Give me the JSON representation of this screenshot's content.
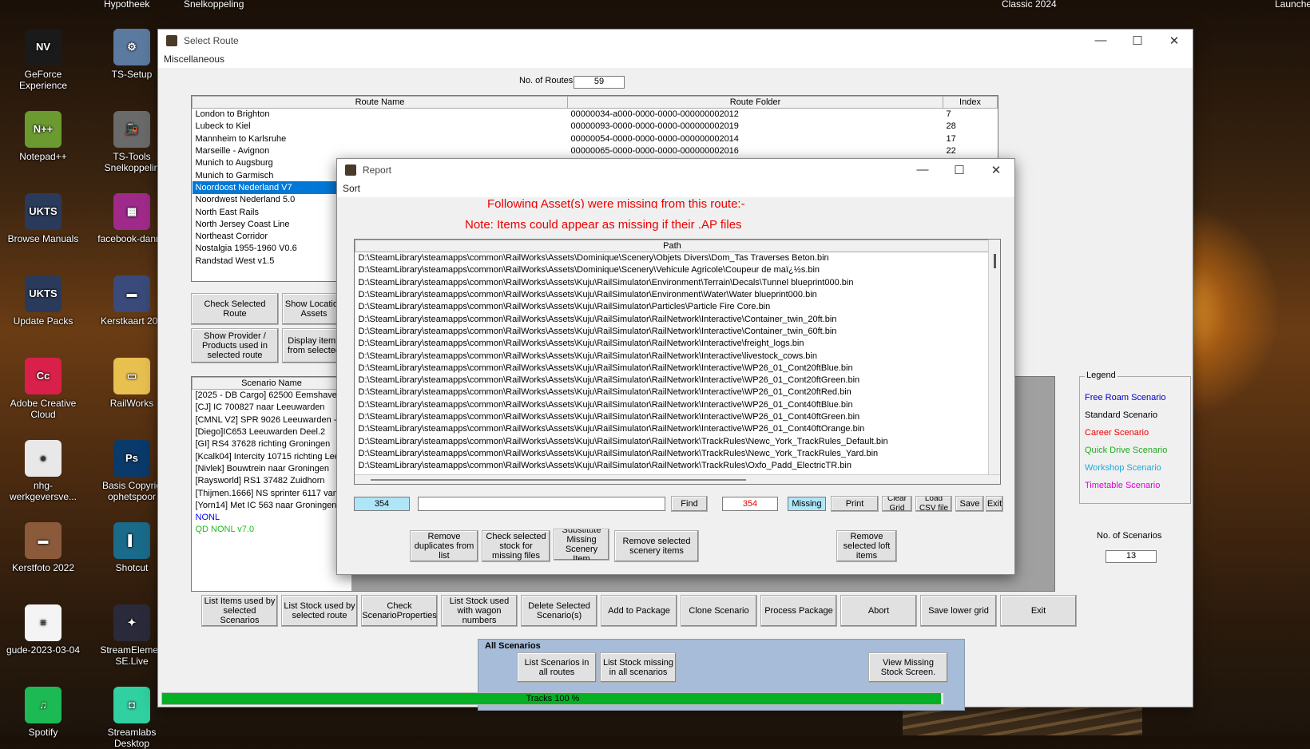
{
  "desktop": {
    "top_labels": [
      "Hypotheek",
      "Snelkoppeling",
      "Classic 2024",
      "Launche"
    ],
    "icons_col1": [
      {
        "label": "GeForce Experience",
        "pic": "NV",
        "color": "#1a1a1a"
      },
      {
        "label": "Notepad++",
        "pic": "N++",
        "color": "#6a9a30"
      },
      {
        "label": "Browse Manuals",
        "pic": "UKTS",
        "color": "#2a3a5a"
      },
      {
        "label": "Update Packs",
        "pic": "UKTS",
        "color": "#2a3a5a"
      },
      {
        "label": "Adobe Creative Cloud",
        "pic": "Cc",
        "color": "#d8204a"
      },
      {
        "label": "nhg-werkgeversve...",
        "pic": "●",
        "color": "#e8e8e8"
      },
      {
        "label": "Kerstfoto 2022",
        "pic": "▬",
        "color": "#8a5a3a"
      },
      {
        "label": "gude-2023-03-04",
        "pic": "≡",
        "color": "#f4f4f4"
      },
      {
        "label": "Spotify",
        "pic": "♫",
        "color": "#1db954"
      }
    ],
    "icons_col2": [
      {
        "label": "TS-Setup",
        "pic": "⚙",
        "color": "#5a7aa0"
      },
      {
        "label": "TS-Tools Snelkoppelin",
        "pic": "🚂",
        "color": "#6a6a6a"
      },
      {
        "label": "facebook-danny",
        "pic": "▦",
        "color": "#a02a8a"
      },
      {
        "label": "Kerstkaart 202",
        "pic": "▬",
        "color": "#3a4a7a"
      },
      {
        "label": "RailWorks",
        "pic": "▭",
        "color": "#e8c050"
      },
      {
        "label": "Basis Copyrig ophetspoor",
        "pic": "Ps",
        "color": "#0a3a6a"
      },
      {
        "label": "Shotcut",
        "pic": "▌",
        "color": "#1a6a8a"
      },
      {
        "label": "StreamElemen SE.Live",
        "pic": "✦",
        "color": "#2a2a3a"
      },
      {
        "label": "Streamlabs Desktop",
        "pic": "◘",
        "color": "#30d0a0"
      }
    ]
  },
  "select_route": {
    "title": "Select Route",
    "menu": "Miscellaneous",
    "no_routes_label": "No. of Routes",
    "no_routes_value": "59",
    "route_headers": [
      "Route Name",
      "Route Folder",
      "Index"
    ],
    "routes": [
      {
        "name": "London to Brighton",
        "folder": "00000034-a000-0000-0000-000000002012",
        "index": "7"
      },
      {
        "name": "Lubeck to Kiel",
        "folder": "00000093-0000-0000-0000-000000002019",
        "index": "28"
      },
      {
        "name": "Mannheim to Karlsruhe",
        "folder": "00000054-0000-0000-0000-000000002014",
        "index": "17"
      },
      {
        "name": "Marseille - Avignon",
        "folder": "00000065-0000-0000-0000-000000002016",
        "index": "22"
      },
      {
        "name": "Munich to Augsburg",
        "folder": "",
        "index": ""
      },
      {
        "name": "Munich to Garmisch",
        "folder": "",
        "index": ""
      },
      {
        "name": "Noordoost Nederland V7",
        "folder": "",
        "index": ""
      },
      {
        "name": "Noordwest Nederland 5.0",
        "folder": "",
        "index": ""
      },
      {
        "name": "North East Rails",
        "folder": "",
        "index": ""
      },
      {
        "name": "North Jersey Coast Line",
        "folder": "",
        "index": ""
      },
      {
        "name": "Northeast Corridor",
        "folder": "",
        "index": ""
      },
      {
        "name": "Nostalgia 1955-1960 V0.6",
        "folder": "",
        "index": ""
      },
      {
        "name": "Randstad West v1.5",
        "folder": "",
        "index": ""
      }
    ],
    "selected_route": "Noordoost Nederland V7",
    "btn_check_route": "Check Selected Route",
    "btn_show_locations": "Show Location Assets",
    "btn_show_provider": "Show Provider / Products used in selected route",
    "btn_display_items": "Display items from selected",
    "scenario_header": "Scenario Name",
    "scenarios": [
      {
        "name": "[2025 - DB Cargo] 62500 Eemshaven",
        "color": "#000"
      },
      {
        "name": "[CJ] IC 700827 naar Leeuwarden",
        "color": "#000"
      },
      {
        "name": "[CMNL V2] SPR 9026 Leeuwarden - N",
        "color": "#000"
      },
      {
        "name": "[Diego]IC653 Leeuwarden Deel.2",
        "color": "#000"
      },
      {
        "name": "[GI] RS4 37628 richting Groningen",
        "color": "#000"
      },
      {
        "name": "[Kcalk04] Intercity 10715 richting Leeu",
        "color": "#000"
      },
      {
        "name": "[Nivlek] Bouwtrein naar Groningen",
        "color": "#000"
      },
      {
        "name": "[Raysworld] RS1 37482 Zuidhorn",
        "color": "#000"
      },
      {
        "name": "[Thijmen.1666] NS sprinter 6117 van Z",
        "color": "#000"
      },
      {
        "name": "[Yorn14] Met IC 563 naar Groningen E",
        "color": "#000"
      },
      {
        "name": "NONL",
        "color": "#0000ff"
      },
      {
        "name": "QD NONL v7.0",
        "color": "#22bb22"
      }
    ],
    "legend_title": "Legend",
    "legend": [
      {
        "label": "Free Roam Scenario",
        "color": "#0000cc"
      },
      {
        "label": "Standard Scenario",
        "color": "#000000"
      },
      {
        "label": "Career Scenario",
        "color": "#ee0000"
      },
      {
        "label": "Quick Drive Scenario",
        "color": "#22aa22"
      },
      {
        "label": "Workshop Scenario",
        "color": "#1aaadd"
      },
      {
        "label": "Timetable Scenario",
        "color": "#dd00dd"
      }
    ],
    "no_scenarios_label": "No. of Scenarios",
    "no_scenarios_value": "13",
    "bottom_buttons": [
      "List Items used by selected Scenarios",
      "List Stock used by selected route",
      "Check ScenarioProperties",
      "List Stock used with wagon numbers",
      "Delete Selected Scenario(s)",
      "Add to Package",
      "Clone Scenario",
      "Process Package",
      "Abort",
      "Save lower grid",
      "Exit"
    ],
    "all_scenarios_title": "All Scenarios",
    "btn_list_scenarios_all": "List Scenarios in all routes",
    "btn_list_stock_missing": "List Stock missing in all scenarios",
    "btn_view_missing": "View Missing Stock Screen.",
    "progress_label": "Tracks 100 %",
    "progress_fraction": 0.997
  },
  "report": {
    "title": "Report",
    "menu": "Sort",
    "msg1": "Following Asset(s) were missing from this route:-",
    "msg2": "Note: Items could appear as missing if their .AP files",
    "path_header": "Path",
    "paths": [
      "D:\\SteamLibrary\\steamapps\\common\\RailWorks\\Assets\\Dominique\\Scenery\\Objets Divers\\Dom_Tas Traverses Beton.bin",
      "D:\\SteamLibrary\\steamapps\\common\\RailWorks\\Assets\\Dominique\\Scenery\\Vehicule Agricole\\Coupeur de maï¿½s.bin",
      "D:\\SteamLibrary\\steamapps\\common\\RailWorks\\Assets\\Kuju\\RailSimulator\\Environment\\Terrain\\Decals\\Tunnel blueprint000.bin",
      "D:\\SteamLibrary\\steamapps\\common\\RailWorks\\Assets\\Kuju\\RailSimulator\\Environment\\Water\\Water blueprint000.bin",
      "D:\\SteamLibrary\\steamapps\\common\\RailWorks\\Assets\\Kuju\\RailSimulator\\Particles\\Particle Fire Core.bin",
      "D:\\SteamLibrary\\steamapps\\common\\RailWorks\\Assets\\Kuju\\RailSimulator\\RailNetwork\\Interactive\\Container_twin_20ft.bin",
      "D:\\SteamLibrary\\steamapps\\common\\RailWorks\\Assets\\Kuju\\RailSimulator\\RailNetwork\\Interactive\\Container_twin_60ft.bin",
      "D:\\SteamLibrary\\steamapps\\common\\RailWorks\\Assets\\Kuju\\RailSimulator\\RailNetwork\\Interactive\\freight_logs.bin",
      "D:\\SteamLibrary\\steamapps\\common\\RailWorks\\Assets\\Kuju\\RailSimulator\\RailNetwork\\Interactive\\livestock_cows.bin",
      "D:\\SteamLibrary\\steamapps\\common\\RailWorks\\Assets\\Kuju\\RailSimulator\\RailNetwork\\Interactive\\WP26_01_Cont20ftBlue.bin",
      "D:\\SteamLibrary\\steamapps\\common\\RailWorks\\Assets\\Kuju\\RailSimulator\\RailNetwork\\Interactive\\WP26_01_Cont20ftGreen.bin",
      "D:\\SteamLibrary\\steamapps\\common\\RailWorks\\Assets\\Kuju\\RailSimulator\\RailNetwork\\Interactive\\WP26_01_Cont20ftRed.bin",
      "D:\\SteamLibrary\\steamapps\\common\\RailWorks\\Assets\\Kuju\\RailSimulator\\RailNetwork\\Interactive\\WP26_01_Cont40ftBlue.bin",
      "D:\\SteamLibrary\\steamapps\\common\\RailWorks\\Assets\\Kuju\\RailSimulator\\RailNetwork\\Interactive\\WP26_01_Cont40ftGreen.bin",
      "D:\\SteamLibrary\\steamapps\\common\\RailWorks\\Assets\\Kuju\\RailSimulator\\RailNetwork\\Interactive\\WP26_01_Cont40ftOrange.bin",
      "D:\\SteamLibrary\\steamapps\\common\\RailWorks\\Assets\\Kuju\\RailSimulator\\RailNetwork\\TrackRules\\Newc_York_TrackRules_Default.bin",
      "D:\\SteamLibrary\\steamapps\\common\\RailWorks\\Assets\\Kuju\\RailSimulator\\RailNetwork\\TrackRules\\Newc_York_TrackRules_Yard.bin",
      "D:\\SteamLibrary\\steamapps\\common\\RailWorks\\Assets\\Kuju\\RailSimulator\\RailNetwork\\TrackRules\\Oxfo_Padd_ElectricTR.bin"
    ],
    "count_left": "354",
    "search_value": "",
    "btn_find": "Find",
    "count_red": "354",
    "missing_label": "Missing",
    "btn_print": "Print",
    "btn_clear_grid": "Clear Grid",
    "btn_load_csv": "Load CSV file",
    "btn_save": "Save",
    "btn_exit": "Exit",
    "btn_remove_dup": "Remove duplicates from list",
    "btn_check_stock": "Check selected stock for missing files",
    "btn_substitute": "Substitute Missing Scenery Item",
    "btn_remove_scenery": "Remove selected scenery items",
    "btn_remove_loft": "Remove selected loft items"
  }
}
